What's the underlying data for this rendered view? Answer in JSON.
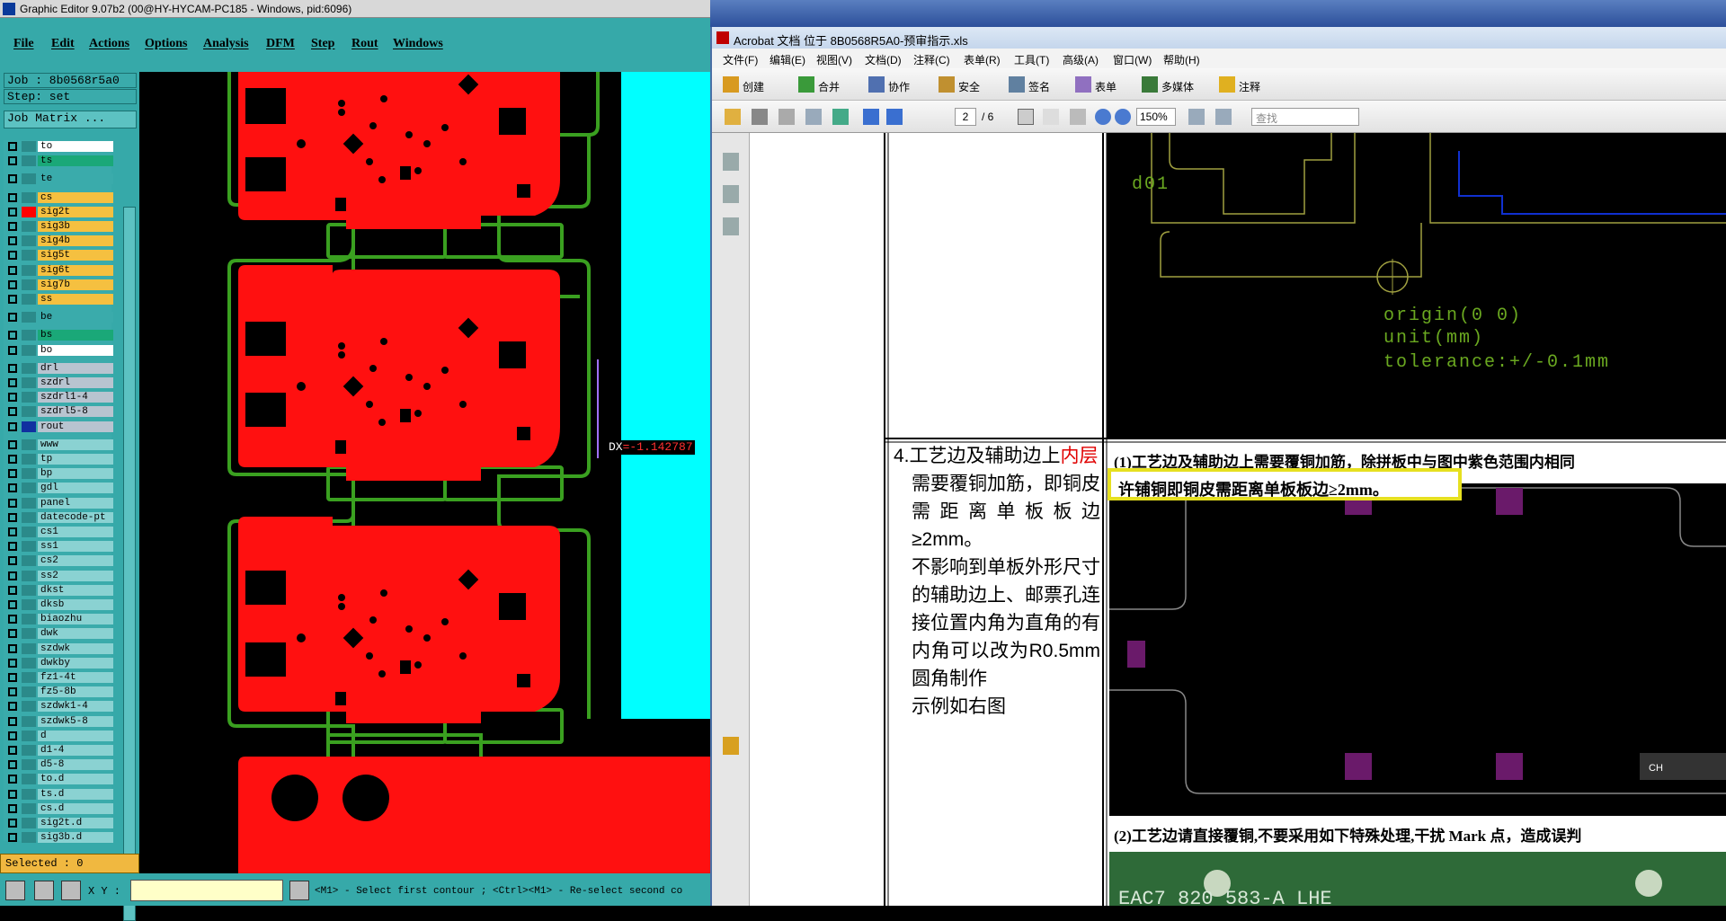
{
  "genesis": {
    "title": "Graphic Editor 9.07b2 (00@HY-HYCAM-PC185 - Windows, pid:6096)",
    "menu": [
      "File",
      "Edit",
      "Actions",
      "Options",
      "Analysis",
      "DFM",
      "Step",
      "Rout",
      "Windows"
    ],
    "job": "Job : 8b0568r5a0",
    "step": "Step: set",
    "job_matrix": "Job Matrix ...",
    "layers": [
      {
        "name": "to",
        "bg": "#ffffff",
        "col": "#2b8a8a"
      },
      {
        "name": "ts",
        "bg": "#1aa878",
        "col": "#2b8a8a"
      },
      {
        "name": "te",
        "bg": "#3aabab",
        "col": "#2b8a8a",
        "gap": true
      },
      {
        "name": "cs",
        "bg": "#f5c040",
        "col": "#2b8a8a",
        "gap": true
      },
      {
        "name": "sig2t",
        "bg": "#f5c040",
        "col": "#ff0000"
      },
      {
        "name": "sig3b",
        "bg": "#f5c040",
        "col": "#2b8a8a"
      },
      {
        "name": "sig4b",
        "bg": "#f5c040",
        "col": "#2b8a8a"
      },
      {
        "name": "sig5t",
        "bg": "#f5c040",
        "col": "#2b8a8a"
      },
      {
        "name": "sig6t",
        "bg": "#f5c040",
        "col": "#2b8a8a"
      },
      {
        "name": "sig7b",
        "bg": "#f5c040",
        "col": "#2b8a8a"
      },
      {
        "name": "ss",
        "bg": "#f5c040",
        "col": "#2b8a8a"
      },
      {
        "name": "be",
        "bg": "#3aabab",
        "col": "#2b8a8a",
        "gap": true
      },
      {
        "name": "bs",
        "bg": "#1aa878",
        "col": "#2b8a8a",
        "gap": true
      },
      {
        "name": "bo",
        "bg": "#ffffff",
        "col": "#2b8a8a"
      },
      {
        "name": "drl",
        "bg": "#b8c4d0",
        "col": "#2b8a8a",
        "gap": true
      },
      {
        "name": "szdrl",
        "bg": "#b8c4d0",
        "col": "#2b8a8a"
      },
      {
        "name": "szdrl1-4",
        "bg": "#b8c4d0",
        "col": "#2b8a8a"
      },
      {
        "name": "szdrl5-8",
        "bg": "#b8c4d0",
        "col": "#2b8a8a"
      },
      {
        "name": "rout",
        "bg": "#b8c4d0",
        "col": "#1030a0"
      },
      {
        "name": "www",
        "bg": "#8ad2d2",
        "col": "#2b8a8a",
        "gap": true
      },
      {
        "name": "tp",
        "bg": "#8ad2d2",
        "col": "#2b8a8a"
      },
      {
        "name": "bp",
        "bg": "#8ad2d2",
        "col": "#2b8a8a"
      },
      {
        "name": "gdl",
        "bg": "#8ad2d2",
        "col": "#2b8a8a"
      },
      {
        "name": "panel",
        "bg": "#8ad2d2",
        "col": "#2b8a8a"
      },
      {
        "name": "datecode-pt",
        "bg": "#8ad2d2",
        "col": "#2b8a8a"
      },
      {
        "name": "cs1",
        "bg": "#8ad2d2",
        "col": "#2b8a8a"
      },
      {
        "name": "ss1",
        "bg": "#8ad2d2",
        "col": "#2b8a8a"
      },
      {
        "name": "cs2",
        "bg": "#8ad2d2",
        "col": "#2b8a8a"
      },
      {
        "name": "ss2",
        "bg": "#8ad2d2",
        "col": "#2b8a8a"
      },
      {
        "name": "dkst",
        "bg": "#8ad2d2",
        "col": "#2b8a8a"
      },
      {
        "name": "dksb",
        "bg": "#8ad2d2",
        "col": "#2b8a8a"
      },
      {
        "name": "biaozhu",
        "bg": "#8ad2d2",
        "col": "#2b8a8a"
      },
      {
        "name": "dwk",
        "bg": "#8ad2d2",
        "col": "#2b8a8a"
      },
      {
        "name": "szdwk",
        "bg": "#8ad2d2",
        "col": "#2b8a8a"
      },
      {
        "name": "dwkby",
        "bg": "#8ad2d2",
        "col": "#2b8a8a"
      },
      {
        "name": "fz1-4t",
        "bg": "#8ad2d2",
        "col": "#2b8a8a"
      },
      {
        "name": "fz5-8b",
        "bg": "#8ad2d2",
        "col": "#2b8a8a"
      },
      {
        "name": "szdwk1-4",
        "bg": "#8ad2d2",
        "col": "#2b8a8a"
      },
      {
        "name": "szdwk5-8",
        "bg": "#8ad2d2",
        "col": "#2b8a8a"
      },
      {
        "name": "d",
        "bg": "#8ad2d2",
        "col": "#2b8a8a"
      },
      {
        "name": "d1-4",
        "bg": "#8ad2d2",
        "col": "#2b8a8a"
      },
      {
        "name": "d5-8",
        "bg": "#8ad2d2",
        "col": "#2b8a8a"
      },
      {
        "name": "to.d",
        "bg": "#8ad2d2",
        "col": "#2b8a8a"
      },
      {
        "name": "ts.d",
        "bg": "#8ad2d2",
        "col": "#2b8a8a"
      },
      {
        "name": "cs.d",
        "bg": "#8ad2d2",
        "col": "#2b8a8a"
      },
      {
        "name": "sig2t.d",
        "bg": "#8ad2d2",
        "col": "#2b8a8a"
      },
      {
        "name": "sig3b.d",
        "bg": "#8ad2d2",
        "col": "#2b8a8a"
      }
    ],
    "selected": "Selected : 0",
    "xy_label": "X Y :",
    "status_prefix": "<M1> - Select first contour ; <Ctrl><M1> - Re-select second co",
    "dx_label": "DX",
    "dx_value": "=-1.142787"
  },
  "acrobat": {
    "title": "Acrobat 文档 位于 8B0568R5A0-预审指示.xls",
    "menu": [
      "文件(F)",
      "编辑(E)",
      "视图(V)",
      "文档(D)",
      "注释(C)",
      "表单(R)",
      "工具(T)",
      "高级(A)",
      "窗口(W)",
      "帮助(H)"
    ],
    "toolbar": [
      "创建",
      "合并",
      "协作",
      "安全",
      "签名",
      "表单",
      "多媒体",
      "注释"
    ],
    "page_current": "2",
    "page_total": "/ 6",
    "zoom": "150%",
    "find_placeholder": "查找",
    "cell": {
      "line1a": "4.工艺边及辅助边上",
      "line1b": "内层",
      "line2": "需要覆铜加筋，即铜皮需距离单板板边≥2mm。",
      "line3": "不影响到单板外形尺寸的辅助边上、邮票孔连接位置内角为直角的有内角可以改为R0.5mm圆角制作",
      "line4": "示例如右图"
    },
    "caption1": "(1)工艺边及辅助边上需要覆铜加筋，除拼板中与图中紫色范围内相同",
    "caption1b": "许铺铜即铜皮需距离单板板边≥2mm。",
    "caption2": "(2)工艺边请直接覆铜,不要采用如下特殊处理,干扰 Mark 点，造成误判",
    "cad_text": {
      "d01": "d01",
      "origin": "origin(0 0)",
      "unit": "unit(mm)",
      "tol": "tolerance:+/-0.1mm"
    },
    "img3_text": "EAC7 820 583-A LHE",
    "ime": "CH"
  }
}
